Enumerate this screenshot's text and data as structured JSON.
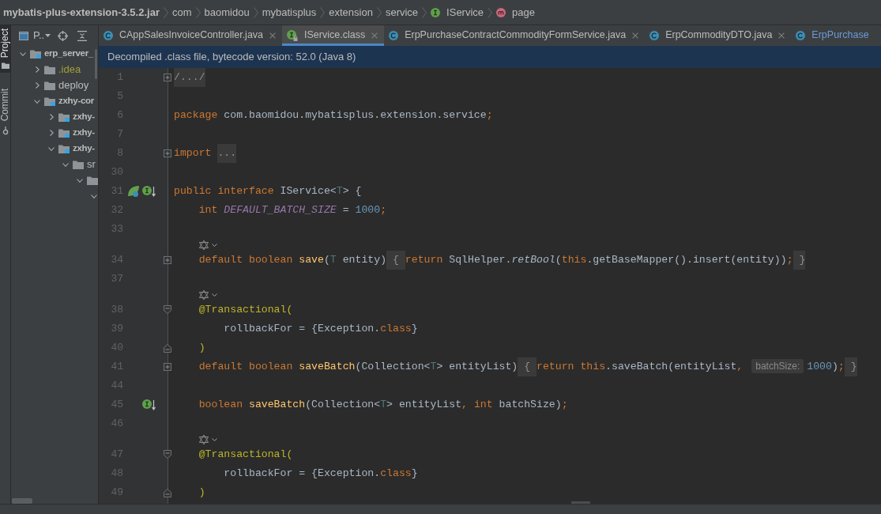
{
  "breadcrumbs": [
    {
      "label": "mybatis-plus-extension-3.5.2.jar",
      "kind": "archive"
    },
    {
      "label": "com",
      "kind": "package"
    },
    {
      "label": "baomidou",
      "kind": "package"
    },
    {
      "label": "mybatisplus",
      "kind": "package"
    },
    {
      "label": "extension",
      "kind": "package"
    },
    {
      "label": "service",
      "kind": "package"
    },
    {
      "label": "IService",
      "kind": "interface"
    },
    {
      "label": "page",
      "kind": "method"
    }
  ],
  "tool_strip": [
    {
      "label": "Project",
      "kind": "project",
      "selected": true
    },
    {
      "label": "Commit",
      "kind": "commit",
      "selected": false
    }
  ],
  "project_panel": {
    "view_selector": "P..",
    "tree": [
      {
        "label": "erp_server_",
        "kind": "module",
        "expanded": true,
        "ignored": false,
        "children": [
          {
            "label": ".idea",
            "kind": "folder",
            "expanded": false,
            "ignored": true
          },
          {
            "label": "deploy",
            "kind": "folder",
            "expanded": false,
            "ignored": false
          },
          {
            "label": "zxhy-cor",
            "kind": "module",
            "expanded": true,
            "ignored": false,
            "children": [
              {
                "label": "zxhy-",
                "kind": "module",
                "expanded": false,
                "ignored": false
              },
              {
                "label": "zxhy-",
                "kind": "module",
                "expanded": false,
                "ignored": false
              },
              {
                "label": "zxhy-",
                "kind": "module",
                "expanded": true,
                "ignored": false,
                "children": [
                  {
                    "label": "sr",
                    "kind": "folder",
                    "expanded": true,
                    "ignored": false,
                    "children": [
                      {
                        "kind": "folder",
                        "expanded": true,
                        "children": [
                          {
                            "kind": "partial",
                            "expanded": true
                          }
                        ]
                      }
                    ]
                  }
                ]
              }
            ]
          }
        ]
      }
    ]
  },
  "tabs": [
    {
      "label": "CAppSalesInvoiceController.java",
      "kind": "class",
      "selected": false,
      "modified": false,
      "closable": true
    },
    {
      "label": "IService.class",
      "kind": "interface",
      "selected": true,
      "modified": false,
      "closable": true
    },
    {
      "label": "ErpPurchaseContractCommodityFormService.java",
      "kind": "class",
      "selected": false,
      "modified": false,
      "closable": true
    },
    {
      "label": "ErpCommodityDTO.java",
      "kind": "class",
      "selected": false,
      "modified": false,
      "closable": true
    },
    {
      "label": "ErpPurchase",
      "kind": "class",
      "selected": false,
      "modified": true,
      "closable": false
    }
  ],
  "banner": "Decompiled .class file, bytecode version: 52.0 (Java 8)",
  "code": [
    {
      "kind": "code",
      "number": "1",
      "fold": {
        "kind": "expand"
      },
      "tokens": [
        {
          "kind": "folded",
          "text": "/.../"
        }
      ]
    },
    {
      "kind": "code",
      "number": "5"
    },
    {
      "kind": "code",
      "number": "6",
      "tokens": [
        {
          "kind": "keyword",
          "text": "package"
        },
        {
          "kind": "plain",
          "text": " com.baomidou.mybatisplus.extension.service"
        },
        {
          "kind": "keyword",
          "text": ";"
        }
      ]
    },
    {
      "kind": "code",
      "number": "7"
    },
    {
      "kind": "code",
      "number": "8",
      "fold": {
        "kind": "expand"
      },
      "tokens": [
        {
          "kind": "keyword",
          "text": "import "
        },
        {
          "kind": "folded",
          "text": "..."
        }
      ]
    },
    {
      "kind": "code",
      "number": "30"
    },
    {
      "kind": "code",
      "number": "31",
      "gutter": [
        {
          "kind": "leaf"
        },
        {
          "kind": "implemented"
        }
      ],
      "tokens": [
        {
          "kind": "keyword",
          "text": "public interface"
        },
        {
          "kind": "plain",
          "text": " IService<"
        },
        {
          "kind": "type_param",
          "text": "T"
        },
        {
          "kind": "plain",
          "text": "> {"
        }
      ]
    },
    {
      "kind": "code",
      "number": "32",
      "tokens": [
        {
          "kind": "keyword",
          "text": "    int "
        },
        {
          "kind": "constant",
          "text": "DEFAULT_BATCH_SIZE"
        },
        {
          "kind": "plain",
          "text": " = "
        },
        {
          "kind": "number",
          "text": "1000"
        },
        {
          "kind": "keyword",
          "text": ";"
        }
      ]
    },
    {
      "kind": "code",
      "number": "33"
    },
    {
      "kind": "hint"
    },
    {
      "kind": "code",
      "number": "34",
      "fold": {
        "kind": "expand"
      },
      "tokens": [
        {
          "kind": "keyword",
          "text": "    default boolean "
        },
        {
          "kind": "method",
          "text": "save"
        },
        {
          "kind": "plain",
          "text": "("
        },
        {
          "kind": "type_param",
          "text": "T"
        },
        {
          "kind": "plain",
          "text": " entity)"
        },
        {
          "kind": "folded",
          "text": " { "
        },
        {
          "kind": "keyword",
          "text": "return"
        },
        {
          "kind": "plain",
          "text": " SqlHelper."
        },
        {
          "kind": "static_call",
          "text": "retBool"
        },
        {
          "kind": "plain",
          "text": "("
        },
        {
          "kind": "keyword",
          "text": "this"
        },
        {
          "kind": "plain",
          "text": ".getBaseMapper().insert(entity))"
        },
        {
          "kind": "keyword",
          "text": ";"
        },
        {
          "kind": "folded",
          "text": " }"
        }
      ]
    },
    {
      "kind": "code",
      "number": "37"
    },
    {
      "kind": "hint"
    },
    {
      "kind": "code",
      "number": "38",
      "fold": {
        "kind": "collapse_start"
      },
      "tokens": [
        {
          "kind": "annotation",
          "text": "    @Transactional("
        }
      ]
    },
    {
      "kind": "code",
      "number": "39",
      "tokens": [
        {
          "kind": "plain",
          "text": "        rollbackFor = {Exception."
        },
        {
          "kind": "keyword",
          "text": "class"
        },
        {
          "kind": "plain",
          "text": "}"
        }
      ]
    },
    {
      "kind": "code",
      "number": "40",
      "fold": {
        "kind": "collapse_end"
      },
      "tokens": [
        {
          "kind": "annotation",
          "text": "    )"
        }
      ]
    },
    {
      "kind": "code",
      "number": "41",
      "fold": {
        "kind": "expand"
      },
      "tokens": [
        {
          "kind": "keyword",
          "text": "    default boolean "
        },
        {
          "kind": "method",
          "text": "saveBatch"
        },
        {
          "kind": "plain",
          "text": "(Collection<"
        },
        {
          "kind": "type_param",
          "text": "T"
        },
        {
          "kind": "plain",
          "text": "> entityList)"
        },
        {
          "kind": "folded",
          "text": " { "
        },
        {
          "kind": "keyword",
          "text": "return this"
        },
        {
          "kind": "plain",
          "text": ".saveBatch(entityList"
        },
        {
          "kind": "keyword",
          "text": ","
        },
        {
          "kind": "param_hint",
          "text": "batchSize:"
        },
        {
          "kind": "number",
          "text": "1000"
        },
        {
          "kind": "plain",
          "text": ")"
        },
        {
          "kind": "keyword",
          "text": ";"
        },
        {
          "kind": "folded",
          "text": " }"
        }
      ]
    },
    {
      "kind": "code",
      "number": "44"
    },
    {
      "kind": "code",
      "number": "45",
      "gutter": [
        {
          "kind": "implemented"
        }
      ],
      "tokens": [
        {
          "kind": "keyword",
          "text": "    boolean "
        },
        {
          "kind": "method",
          "text": "saveBatch"
        },
        {
          "kind": "plain",
          "text": "(Collection<"
        },
        {
          "kind": "type_param",
          "text": "T"
        },
        {
          "kind": "plain",
          "text": "> entityList"
        },
        {
          "kind": "keyword",
          "text": ", int"
        },
        {
          "kind": "plain",
          "text": " batchSize)"
        },
        {
          "kind": "keyword",
          "text": ";"
        }
      ]
    },
    {
      "kind": "code",
      "number": "46"
    },
    {
      "kind": "hint"
    },
    {
      "kind": "code",
      "number": "47",
      "fold": {
        "kind": "collapse_start"
      },
      "tokens": [
        {
          "kind": "annotation",
          "text": "    @Transactional("
        }
      ]
    },
    {
      "kind": "code",
      "number": "48",
      "tokens": [
        {
          "kind": "plain",
          "text": "        rollbackFor = {Exception."
        },
        {
          "kind": "keyword",
          "text": "class"
        },
        {
          "kind": "plain",
          "text": "}"
        }
      ]
    },
    {
      "kind": "code",
      "number": "49",
      "fold": {
        "kind": "collapse_end"
      },
      "tokens": [
        {
          "kind": "annotation",
          "text": "    )"
        }
      ]
    }
  ]
}
